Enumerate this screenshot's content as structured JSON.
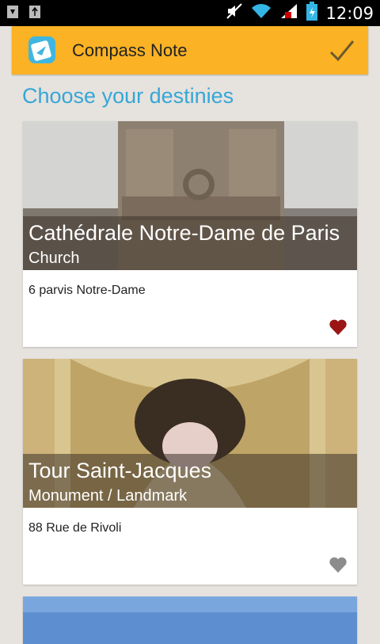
{
  "status_bar": {
    "time": "12:09",
    "icons": [
      "download-icon",
      "usb-icon",
      "mute-icon",
      "wifi-icon",
      "signal-icon",
      "battery-icon"
    ]
  },
  "action_bar": {
    "title": "Compass Note",
    "app_icon": "compass-note-icon",
    "done_icon": "checkmark-icon",
    "background": "#fbb224"
  },
  "section": {
    "title": "Choose your destinies",
    "color": "#35a7d6"
  },
  "cards": [
    {
      "name": "Cathédrale Notre-Dame de Paris",
      "type": "Church",
      "address": "6 parvis Notre-Dame",
      "favorite": true,
      "favorite_color": "#9b1515"
    },
    {
      "name": "Tour Saint-Jacques",
      "type": "Monument / Landmark",
      "address": "88 Rue de Rivoli",
      "favorite": false,
      "favorite_color": "#8c8c8c"
    }
  ]
}
